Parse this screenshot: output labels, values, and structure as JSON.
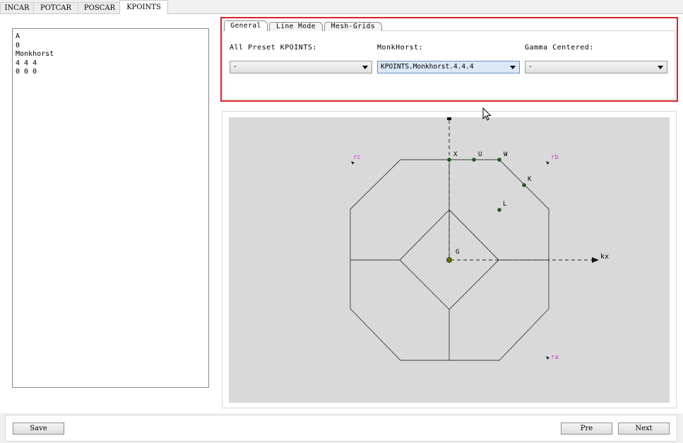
{
  "top_tabs": [
    "INCAR",
    "POTCAR",
    "POSCAR",
    "KPOINTS"
  ],
  "active_top_tab": "KPOINTS",
  "kpoints_text": "A\n0\nMonkhorst\n4 4 4\n0 0 0",
  "sub_tabs": [
    "General",
    "Line Mode",
    "Mesh-Grids"
  ],
  "active_sub_tab": "General",
  "fields": {
    "preset": {
      "label": "All Preset KPOINTS:",
      "value": "-"
    },
    "monkhorst": {
      "label": "MonkHorst:",
      "value": "KPOINTS.Monkhorst.4.4.4"
    },
    "gamma": {
      "label": "Gamma Centered:",
      "value": "-"
    }
  },
  "diagram": {
    "axis_label": "kx",
    "points": [
      "X",
      "U",
      "W",
      "K",
      "L",
      "G"
    ],
    "vector_labels": [
      "rc",
      "rb",
      "ra"
    ],
    "point_color": "#1f5b1f",
    "vector_color": "#e030e0"
  },
  "buttons": {
    "save": "Save",
    "pre": "Pre",
    "next": "Next"
  },
  "colors": {
    "highlight": "#d8232a",
    "selected_combo": "#dbe8f6"
  }
}
